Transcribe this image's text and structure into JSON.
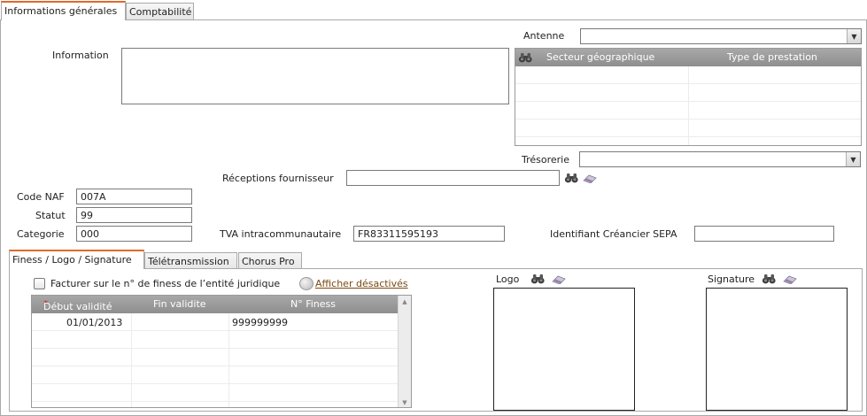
{
  "tabs": {
    "general": "Informations générales",
    "compta": "Comptabilité"
  },
  "fields": {
    "antenne_label": "Antenne",
    "antenne_value": "",
    "information_label": "Information",
    "information_value": "",
    "tresorerie_label": "Trésorerie",
    "tresorerie_value": "",
    "receptions_label": "Réceptions fournisseur",
    "receptions_value": "",
    "code_naf_label": "Code NAF",
    "code_naf_value": "007A",
    "statut_label": "Statut",
    "statut_value": "99",
    "categorie_label": "Categorie",
    "categorie_value": "000",
    "tva_label": "TVA intracommunautaire",
    "tva_value": "FR83311595193",
    "sepa_label": "Identifiant Créancier SEPA",
    "sepa_value": ""
  },
  "secteur_grid": {
    "columns": [
      "Secteur géographique",
      "Type de prestation"
    ],
    "rows": []
  },
  "subtabs": {
    "finess": "Finess / Logo / Signature",
    "teletrans": "Télétransmission",
    "chorus": "Chorus Pro"
  },
  "finess": {
    "checkbox_label": "Facturer sur le n° de finess de l’entité juridique",
    "checkbox_checked": false,
    "show_disabled_link": "Afficher désactivés",
    "columns": [
      "Début validité",
      "Fin validite",
      "N° Finess"
    ],
    "required_mark": "*",
    "rows": [
      {
        "debut": "01/01/2013",
        "fin": "",
        "numero": "999999999"
      }
    ]
  },
  "logo_label": "Logo",
  "signature_label": "Signature",
  "colors": {
    "active_tab_accent": "#e06a2a",
    "grid_header": "#9a9a9a",
    "link": "#7a4a10",
    "required": "#cc2222"
  }
}
